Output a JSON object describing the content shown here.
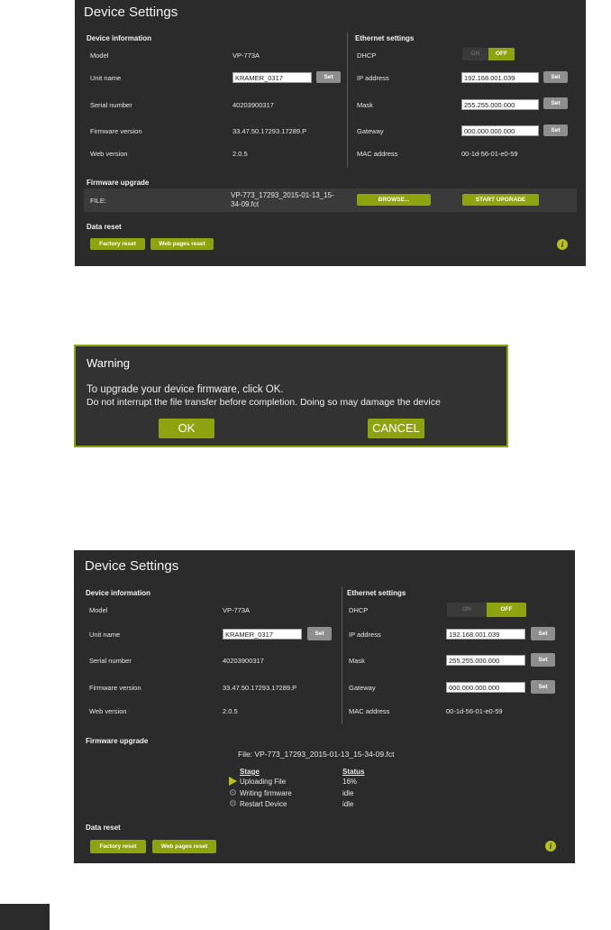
{
  "panel1": {
    "title": "Device Settings",
    "device_info": {
      "heading": "Device information",
      "rows": [
        {
          "label": "Model",
          "value": "VP-773A"
        },
        {
          "label": "Unit name",
          "value": "KRAMER_0317"
        },
        {
          "label": "Serial number",
          "value": "40203900317"
        },
        {
          "label": "Firmware version",
          "value": "33.47.50.17293.17289.P"
        },
        {
          "label": "Web version",
          "value": "2.0.5"
        }
      ],
      "set_label": "Set"
    },
    "ethernet": {
      "heading": "Ethernet settings",
      "dhcp_label": "DHCP",
      "dhcp_on": "ON",
      "dhcp_off": "OFF",
      "ip_label": "IP address",
      "ip_value": "192.168.001.039",
      "mask_label": "Mask",
      "mask_value": "255.255.000.000",
      "gateway_label": "Gateway",
      "gateway_value": "000.000.000.000",
      "mac_label": "MAC address",
      "mac_value": "00-1d-56-01-e0-59",
      "set_label": "Set"
    },
    "firmware": {
      "heading": "Firmware upgrade",
      "file_label": "FILE:",
      "file_line1": "VP-773_17293_2015-01-13_15-",
      "file_line2": "34-09.fct",
      "browse": "BROWSE...",
      "start": "START UPGRADE"
    },
    "data_reset": {
      "heading": "Data reset",
      "factory": "Factory reset",
      "web_pages": "Web pages reset"
    },
    "info_glyph": "i"
  },
  "dialog": {
    "title": "Warning",
    "line1": "To upgrade your device firmware, click OK.",
    "line2": "Do not interrupt the file transfer before completion. Doing so may damage the device",
    "ok": "OK",
    "cancel": "CANCEL"
  },
  "panel2": {
    "title": "Device Settings",
    "device_info": {
      "heading": "Device information",
      "model_label": "Model",
      "model_value": "VP-773A",
      "unit_label": "Unit name",
      "unit_value": "KRAMER_0317",
      "serial_label": "Serial number",
      "serial_value": "40203900317",
      "fw_label": "Firmware version",
      "fw_value": "33.47.50.17293.17289.P",
      "web_label": "Web version",
      "web_value": "2.0.5",
      "set_label": "Set"
    },
    "ethernet": {
      "heading": "Ethernet settings",
      "dhcp_label": "DHCP",
      "dhcp_on": "ON",
      "dhcp_off": "OFF",
      "ip_label": "IP address",
      "ip_value": "192.168.001.039",
      "mask_label": "Mask",
      "mask_value": "255.255.000.000",
      "gateway_label": "Gateway",
      "gateway_value": "000.000.000.000",
      "mac_label": "MAC address",
      "mac_value": "00-1d-56-01-e0-59",
      "set_label": "Set"
    },
    "firmware": {
      "heading": "Firmware upgrade",
      "file_text": "File:  VP-773_17293_2015-01-13_15-34-09.fct",
      "stage_header": "Stage",
      "status_header": "Status",
      "stages": [
        {
          "name": "Uploading File",
          "status": "16%",
          "icon": "play-icon"
        },
        {
          "name": "Writing firmware",
          "status": "idle",
          "icon": "gear-icon"
        },
        {
          "name": "Restart Device",
          "status": "idle",
          "icon": "gear-icon"
        }
      ]
    },
    "data_reset": {
      "heading": "Data reset",
      "factory": "Factory reset",
      "web_pages": "Web pages reset"
    },
    "info_glyph": "i"
  },
  "colors": {
    "accent": "#8da30f",
    "panel_bg": "#2b2b2b",
    "dialog_border": "#8da30f"
  }
}
